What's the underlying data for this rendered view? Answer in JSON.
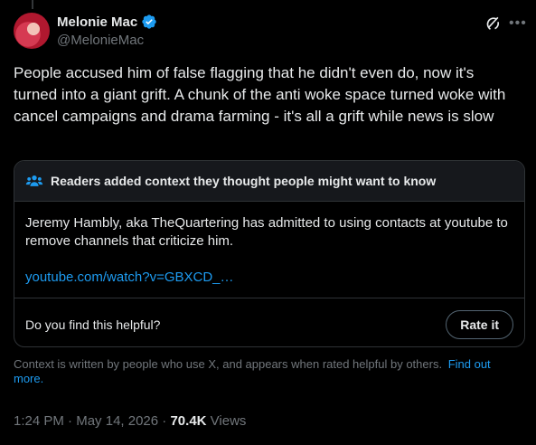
{
  "author": {
    "display_name": "Melonie Mac",
    "handle": "@MelonieMac",
    "verified_color": "#1d9bf0"
  },
  "tweet": {
    "text": "People accused him of false flagging that he didn't even do, now it's turned into a giant grift. A chunk of the anti woke space turned woke with cancel campaigns and drama farming - it's all a grift while news is slow"
  },
  "community_note": {
    "title": "Readers added context they thought people might want to know",
    "body": "Jeremy Hambly, aka TheQuartering has admitted to using contacts at youtube to remove channels that criticize him.",
    "link": "youtube.com/watch?v=GBXCD_…",
    "helpful_question": "Do you find this helpful?",
    "rate_label": "Rate it"
  },
  "context_footnote": {
    "text": "Context is written by people who use X, and appears when rated helpful by others.",
    "link_label": "Find out more."
  },
  "meta": {
    "time": "1:24 PM",
    "separator1": "·",
    "date": "May 14, 2026",
    "separator2": "·",
    "views_count": "70.4K",
    "views_label": "Views"
  },
  "icons": {
    "verified": "verified-badge-icon",
    "grok": "grok-icon",
    "more": "more-icon",
    "community": "people-icon"
  }
}
